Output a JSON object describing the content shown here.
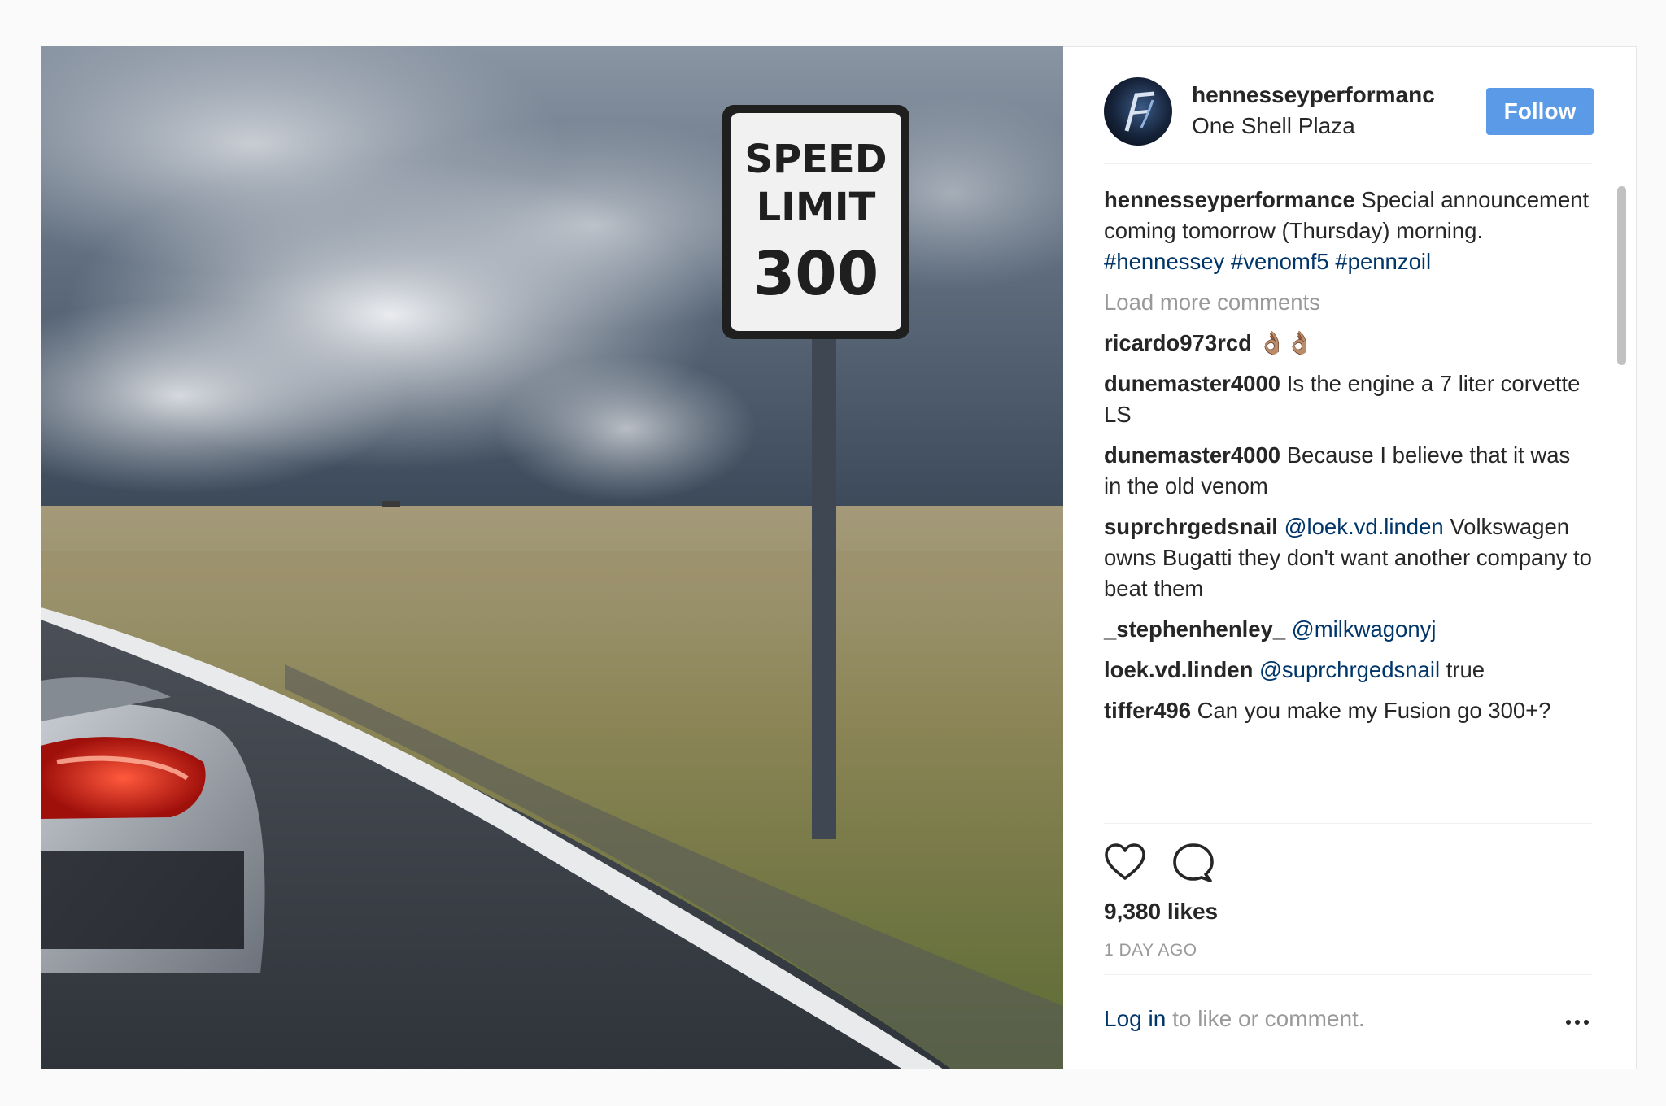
{
  "post": {
    "username": "hennesseyperformanc",
    "location": "One Shell Plaza",
    "follow_label": "Follow",
    "image_sign": {
      "line1": "SPEED",
      "line2": "LIMIT",
      "line3": "300"
    }
  },
  "caption": {
    "user": "hennesseyperformance",
    "text": "Special announcement coming tomorrow (Thursday) morning.",
    "hashtags": [
      "#hennessey",
      "#venomf5",
      "#pennzoil"
    ]
  },
  "load_more_label": "Load more comments",
  "comments": [
    {
      "user": "ricardo973rcd",
      "mention": "",
      "text": "👌🏽👌🏽"
    },
    {
      "user": "dunemaster4000",
      "mention": "",
      "text": "Is the engine a 7 liter corvette LS"
    },
    {
      "user": "dunemaster4000",
      "mention": "",
      "text": "Because I believe that it was in the old venom"
    },
    {
      "user": "suprchrgedsnail",
      "mention": "@loek.vd.linden",
      "text": "Volkswagen owns Bugatti they don't want another company to beat them"
    },
    {
      "user": "_stephenhenley_",
      "mention": "@milkwagonyj",
      "text": ""
    },
    {
      "user": "loek.vd.linden",
      "mention": "@suprchrgedsnail",
      "text": "true"
    },
    {
      "user": "tiffer496",
      "mention": "",
      "text": "Can you make my Fusion go 300+?"
    }
  ],
  "icons": {
    "like": "heart-icon",
    "comment": "comment-bubble-icon",
    "more": "more-dots-icon"
  },
  "likes_label": "9,380 likes",
  "time_ago": "1 DAY AGO",
  "login": {
    "link": "Log in",
    "rest": " to like or comment."
  },
  "colors": {
    "follow_button": "#5b9ae6",
    "mention_link": "#003569",
    "muted_text": "#999999"
  }
}
